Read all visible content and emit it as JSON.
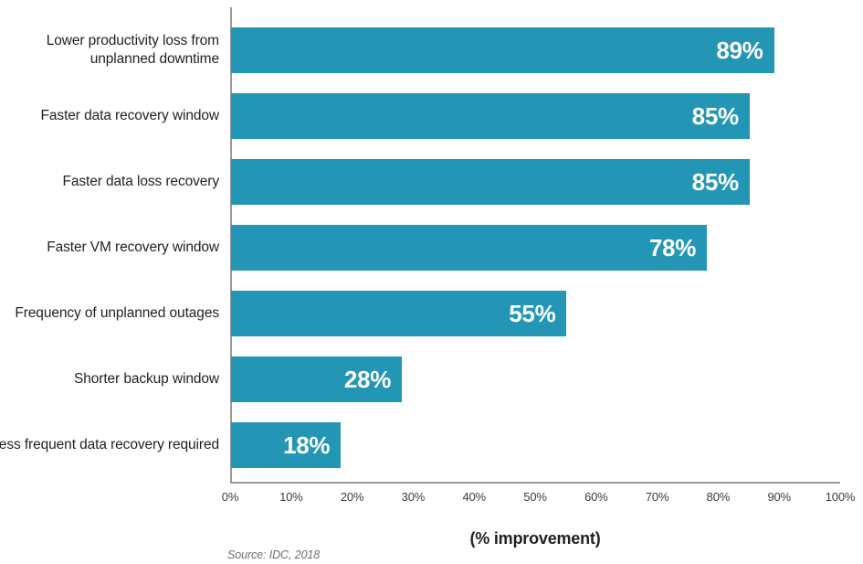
{
  "chart_data": {
    "type": "bar",
    "orientation": "horizontal",
    "title": "",
    "subtitle": "",
    "xlabel": "(% improvement)",
    "ylabel": "",
    "xlim": [
      0,
      100
    ],
    "xtick_labels": [
      "0%",
      "10%",
      "20%",
      "30%",
      "40%",
      "50%",
      "60%",
      "70%",
      "80%",
      "90%",
      "100%"
    ],
    "xtick_values": [
      0,
      10,
      20,
      30,
      40,
      50,
      60,
      70,
      80,
      90,
      100
    ],
    "grid": false,
    "legend": "none",
    "categories": [
      "Lower productivity loss from unplanned downtime",
      "Faster data recovery window",
      "Faster data loss recovery",
      "Faster VM recovery window",
      "Frequency of unplanned outages",
      "Shorter backup window",
      "Less frequent data recovery required"
    ],
    "category_lines": [
      [
        "Lower productivity loss from",
        "unplanned downtime"
      ],
      [
        "Faster data recovery window"
      ],
      [
        "Faster data loss recovery"
      ],
      [
        "Faster VM recovery window"
      ],
      [
        "Frequency of unplanned outages"
      ],
      [
        "Shorter backup window"
      ],
      [
        "Less frequent data recovery required"
      ]
    ],
    "values": [
      89,
      85,
      85,
      78,
      55,
      28,
      18
    ],
    "data_labels": [
      "89%",
      "85%",
      "85%",
      "78%",
      "55%",
      "28%",
      "18%"
    ],
    "bar_color": "#2396b5",
    "data_label_color": "#ffffff",
    "axis_color": "#9a9a9e",
    "text_color": "#231f20",
    "source_note": "Source: IDC, 2018"
  }
}
